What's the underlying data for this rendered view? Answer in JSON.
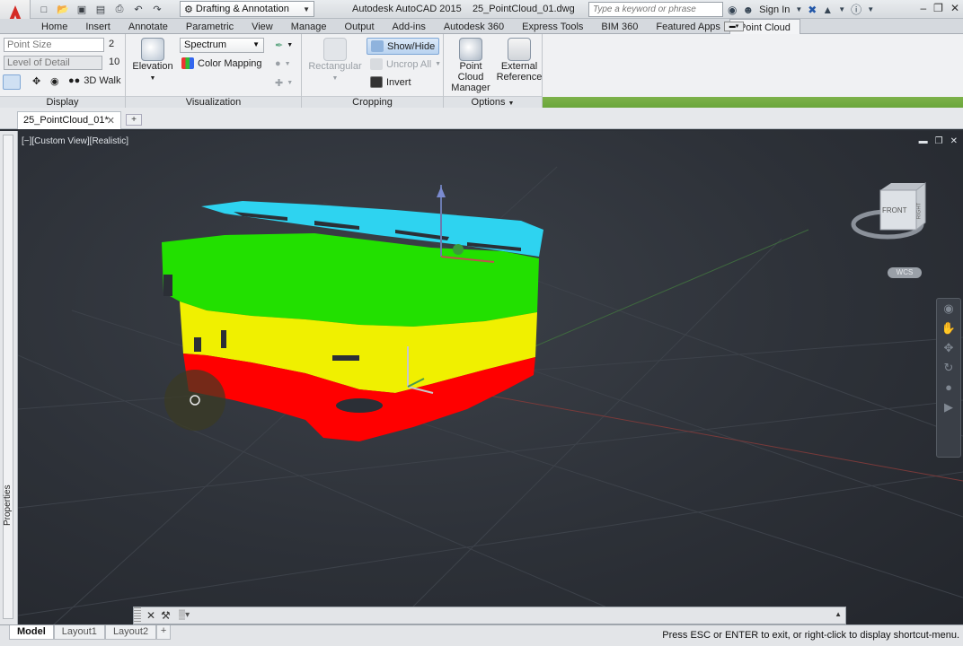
{
  "title_bar": {
    "workspace": "Drafting & Annotation",
    "app_title": "Autodesk AutoCAD 2015",
    "file_title": "25_PointCloud_01.dwg",
    "search_placeholder": "Type a keyword or phrase",
    "sign_in": "Sign In"
  },
  "ribbon_tabs": [
    "Home",
    "Insert",
    "Annotate",
    "Parametric",
    "View",
    "Manage",
    "Output",
    "Add-ins",
    "Autodesk 360",
    "Express Tools",
    "BIM 360",
    "Featured Apps",
    "Point Cloud"
  ],
  "active_tab": "Point Cloud",
  "panels": {
    "display": {
      "label": "Display",
      "point_size_label": "Point Size",
      "point_size_value": "2",
      "lod_label": "Level of Detail",
      "lod_value": "10",
      "walk_label": "3D Walk"
    },
    "visualization": {
      "label": "Visualization",
      "elevation_label": "Elevation",
      "spectrum_value": "Spectrum",
      "color_mapping_label": "Color Mapping"
    },
    "cropping": {
      "label": "Cropping",
      "rectangular_label": "Rectangular",
      "show_hide_label": "Show/Hide",
      "uncrop_all_label": "Uncrop All",
      "invert_label": "Invert"
    },
    "options": {
      "label": "Options",
      "manager_label_1": "Point Cloud",
      "manager_label_2": "Manager",
      "xref_label_1": "External",
      "xref_label_2": "Reference"
    }
  },
  "file_tab": "25_PointCloud_01*",
  "viewport": {
    "label": "[−][Custom View][Realistic]",
    "viewcube_front": "FRONT",
    "viewcube_right": "RIGHT",
    "wcs_label": "WCS"
  },
  "properties_label": "Properties",
  "layout_tabs": [
    "Model",
    "Layout1",
    "Layout2"
  ],
  "active_layout": "Model",
  "status_message": "Press ESC or ENTER to exit, or right-click to display shortcut-menu.",
  "colors": {
    "cloud_cyan": "#2ed3f0",
    "cloud_green": "#22e000",
    "cloud_yellow": "#f0f000",
    "cloud_red": "#ff0000",
    "ribbon_accent": "#7db24a"
  }
}
